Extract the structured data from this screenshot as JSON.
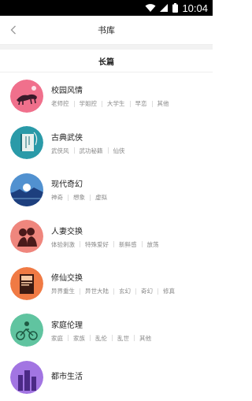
{
  "status_bar": {
    "time": "10:04"
  },
  "nav": {
    "title": "书库"
  },
  "section": {
    "title": "长篇"
  },
  "categories": [
    {
      "name": "校园风情",
      "tags": [
        "老师控",
        "学姐控",
        "大学生",
        "早恋",
        "其他"
      ],
      "color": "#e85a7a"
    },
    {
      "name": "古典武侠",
      "tags": [
        "武侠风",
        "武功秘籍",
        "仙侠"
      ],
      "color": "#2a9aa8"
    },
    {
      "name": "现代奇幻",
      "tags": [
        "神奇",
        "想象",
        "虚拟"
      ],
      "color": "#2b5fb0"
    },
    {
      "name": "人妻交换",
      "tags": [
        "体验刺激",
        "特殊爱好",
        "新鲜感",
        "放荡"
      ],
      "color": "#e8736c"
    },
    {
      "name": "修仙交换",
      "tags": [
        "异界重生",
        "异世大陆",
        "玄幻",
        "奇幻",
        "修真"
      ],
      "color": "#f07a44"
    },
    {
      "name": "家庭伦理",
      "tags": [
        "家庭",
        "家族",
        "乱伦",
        "乱世",
        "其他"
      ],
      "color": "#3bb48a"
    },
    {
      "name": "都市生活",
      "tags": [],
      "color": "#8a5ad6"
    }
  ]
}
